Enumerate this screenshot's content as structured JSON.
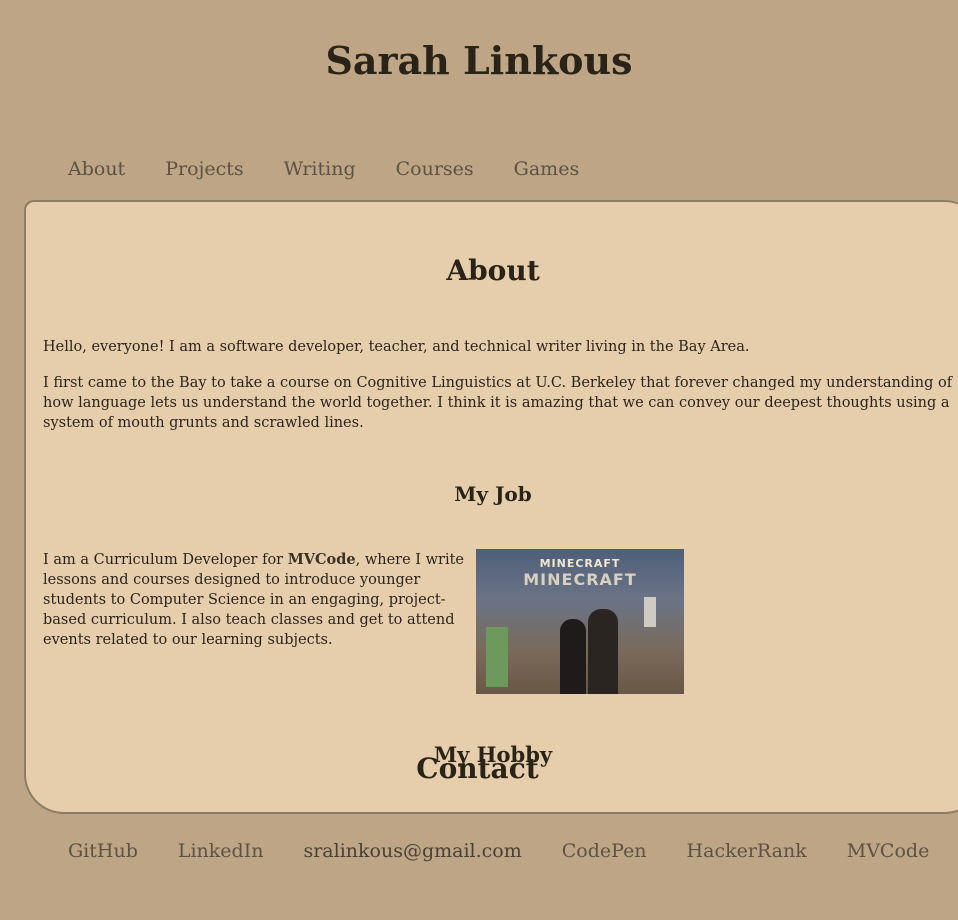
{
  "site": {
    "title": "Sarah Linkous"
  },
  "nav": {
    "items": [
      "About",
      "Projects",
      "Writing",
      "Courses",
      "Games"
    ]
  },
  "about": {
    "heading": "About",
    "intro": "Hello, everyone! I am a software developer, teacher, and technical writer living in the Bay Area.",
    "story": "I first came to the Bay to take a course on Cognitive Linguistics at U.C. Berkeley that forever changed my understanding of how language lets us understand the world together. I think it is amazing that we can convey our deepest thoughts using a system of mouth grunts and scrawled lines."
  },
  "job": {
    "heading": "My Job",
    "text_before": "I am a Curriculum Developer for ",
    "link": "MVCode",
    "text_after": ", where I write lessons and courses designed to introduce younger students to Computer Science in an engaging, project-based curriculum. I also teach classes and get to attend events related to our learning subjects.",
    "photo_caption_small": "MINECRAFT",
    "photo_caption_big": "MINECRAFT"
  },
  "hobby": {
    "heading": "My Hobby"
  },
  "contact": {
    "heading": "Contact",
    "links": [
      "GitHub",
      "LinkedIn",
      "sralinkous@gmail.com",
      "CodePen",
      "HackerRank",
      "MVCode"
    ]
  }
}
